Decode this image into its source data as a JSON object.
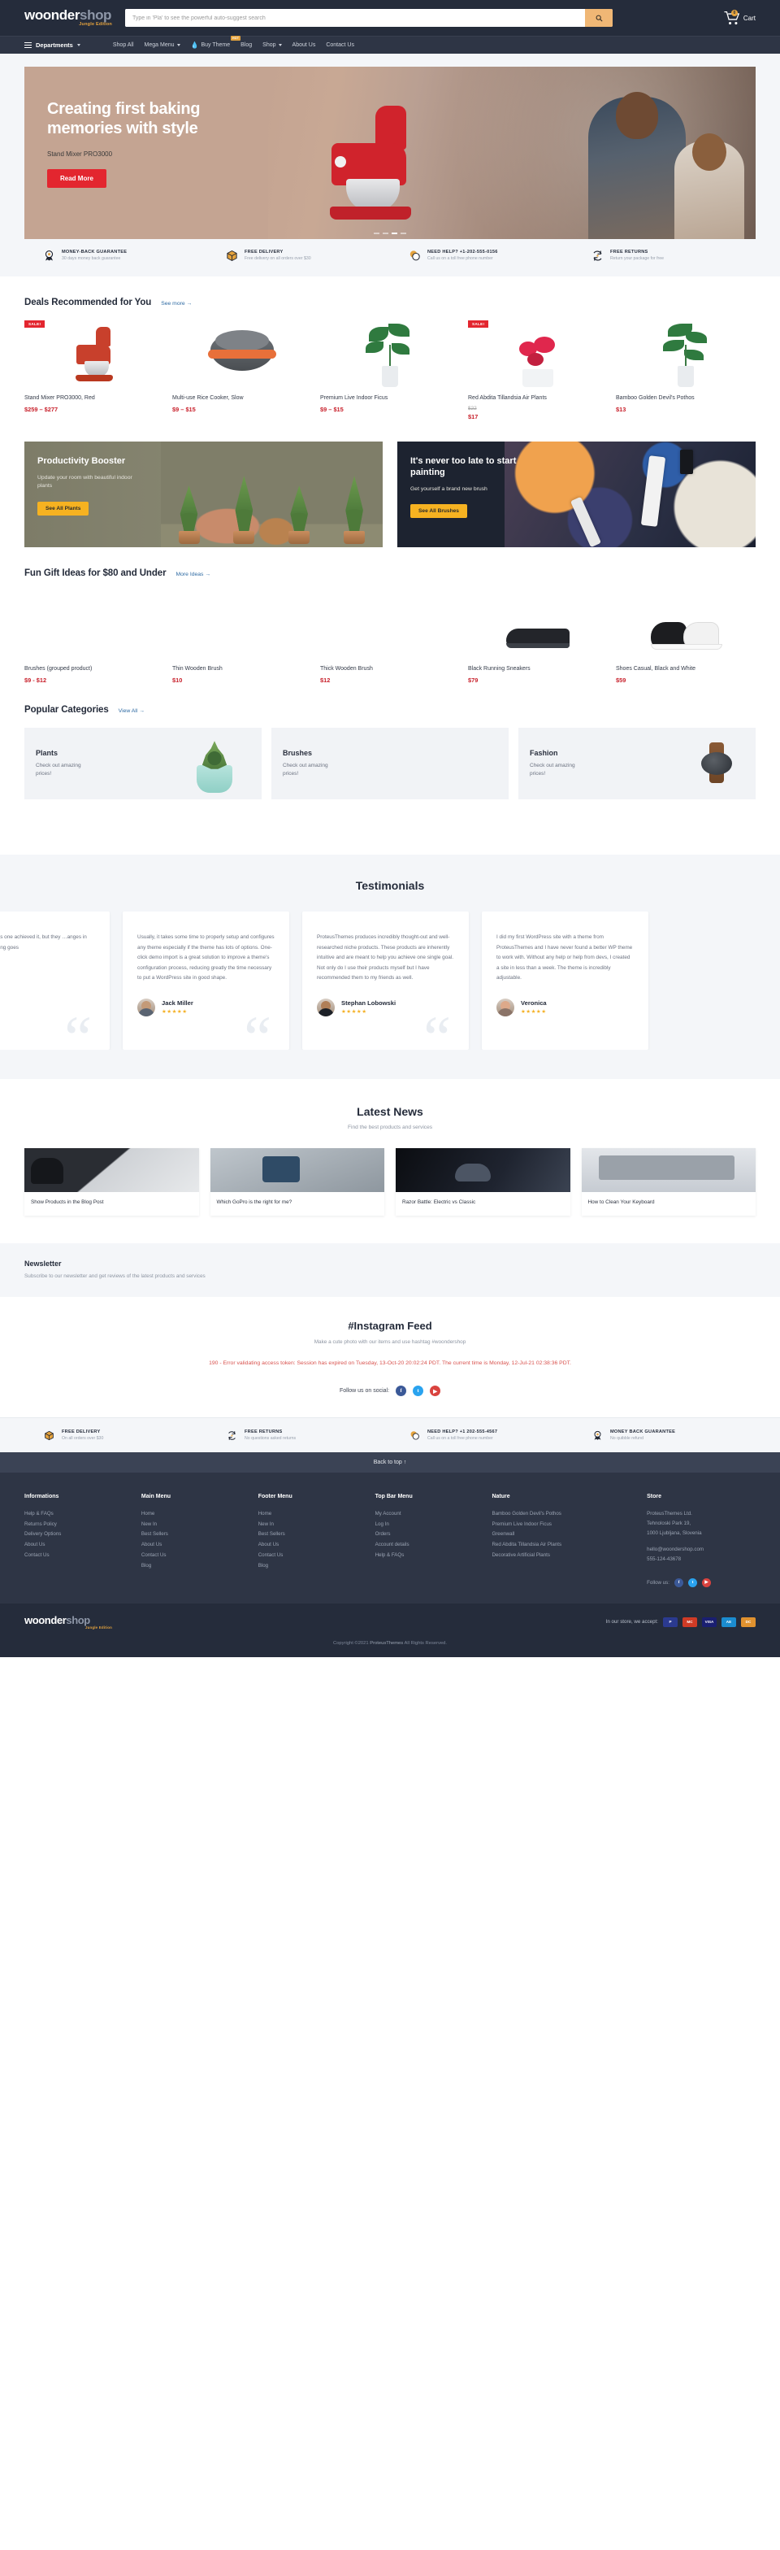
{
  "brand": {
    "name_bold": "woonder",
    "name_light": "shop",
    "tagline": "Jungle Edition"
  },
  "header": {
    "search_placeholder": "Type in 'Pla' to see the powerful auto-suggest search",
    "search_value": "",
    "search_icon": "search-icon",
    "cart_label": "Cart",
    "cart_count": "0",
    "cart_icon": "shopping-cart-icon"
  },
  "nav": {
    "departments_label": "Departments",
    "items": [
      {
        "label": "Shop All",
        "has_caret": false,
        "badge": "",
        "icon": ""
      },
      {
        "label": "Mega Menu",
        "has_caret": true,
        "badge": "",
        "icon": ""
      },
      {
        "label": "Buy Theme",
        "has_caret": false,
        "badge": "HOT",
        "icon": "flame-icon"
      },
      {
        "label": "Blog",
        "has_caret": false,
        "badge": "",
        "icon": ""
      },
      {
        "label": "Shop",
        "has_caret": true,
        "badge": "",
        "icon": ""
      },
      {
        "label": "About Us",
        "has_caret": false,
        "badge": "",
        "icon": ""
      },
      {
        "label": "Contact Us",
        "has_caret": false,
        "badge": "",
        "icon": ""
      }
    ]
  },
  "hero": {
    "title": "Creating first baking memories with style",
    "subtitle": "Stand Mixer PRO3000",
    "button": "Read More",
    "slides": 4,
    "active_slide": 3
  },
  "services": [
    {
      "icon": "medal-icon",
      "title": "MONEY-BACK GUARANTEE",
      "desc": "30 days money back guarantee"
    },
    {
      "icon": "box-icon",
      "title": "FREE DELIVERY",
      "desc": "Free delivery on all orders over $30"
    },
    {
      "icon": "chat-bubbles-icon",
      "title": "NEED HELP? +1-202-555-0156",
      "desc": "Call us on a toll free phone number"
    },
    {
      "icon": "refresh-icon",
      "title": "FREE RETURNS",
      "desc": "Return your package for free"
    }
  ],
  "deals": {
    "title": "Deals Recommended for You",
    "link": "See more →",
    "products": [
      {
        "name": "Stand Mixer PRO3000, Red",
        "price": "$259 – $277",
        "old_price": "",
        "badge": "SALE!",
        "art": "mixer"
      },
      {
        "name": "Multi-use Rice Cooker, Slow",
        "price": "$9 – $15",
        "old_price": "",
        "badge": "",
        "art": "cooker"
      },
      {
        "name": "Premium Live Indoor Ficus",
        "price": "$9 – $15",
        "old_price": "",
        "badge": "",
        "art": "plant"
      },
      {
        "name": "Red Abdita Tillandsia Air Plants",
        "price": "$17",
        "old_price": "$22",
        "badge": "SALE!",
        "art": "flower"
      },
      {
        "name": "Bamboo Golden Devil's Pothos",
        "price": "$13",
        "old_price": "",
        "badge": "",
        "art": "pothos"
      }
    ]
  },
  "promos": [
    {
      "title": "Productivity Booster",
      "sub": "Update your room with beautiful indoor plants",
      "button": "See All Plants",
      "style": "plants"
    },
    {
      "title": "It's never too late to start painting",
      "sub": "Get yourself a brand new brush",
      "button": "See All Brushes",
      "style": "paint"
    }
  ],
  "gifts": {
    "title": "Fun Gift Ideas for $80 and Under",
    "link": "More Ideas →",
    "products": [
      {
        "name": "Brushes (grouped product)",
        "price": "$9 - $12",
        "art": "brushes3"
      },
      {
        "name": "Thin Wooden Brush",
        "price": "$10",
        "art": "brush1"
      },
      {
        "name": "Thick Wooden Brush",
        "price": "$12",
        "art": "brush1"
      },
      {
        "name": "Black Running Sneakers",
        "price": "$79",
        "art": "shoe"
      },
      {
        "name": "Shoes Casual, Black and White",
        "price": "$59",
        "art": "sneakers"
      }
    ]
  },
  "categories": {
    "title": "Popular Categories",
    "link": "View All →",
    "items": [
      {
        "name": "Plants",
        "desc": "Check out amazing prices!",
        "art": "succulent"
      },
      {
        "name": "Brushes",
        "desc": "Check out amazing prices!",
        "art": "brushes"
      },
      {
        "name": "Fashion",
        "desc": "Check out amazing prices!",
        "art": "watch"
      }
    ]
  },
  "testimonials": {
    "title": "Testimonials",
    "items": [
      {
        "text": "…re so well built as one achieved it, but they …anges in the other …verything goes",
        "name": "",
        "stars": "",
        "partial": true
      },
      {
        "text": "Usually, it takes some time to properly setup and configures any theme especially if the theme has lots of options. One-click demo import is a great solution to improve a theme's configuration process, reducing greatly the time necessary to put a WordPress site in good shape.",
        "name": "Jack Miller",
        "stars": "★★★★★",
        "partial": false
      },
      {
        "text": "ProteusThemes produces incredibly thought-out and well-researched niche products. These products are inherently intuitive and are meant to help you achieve one single goal. Not only do I use their products myself but I have recommended them to my friends as well.",
        "name": "Stephan Lobowski",
        "stars": "★★★★★",
        "partial": false
      },
      {
        "text": "I did my first WordPress site with a theme from ProteusThemes and I have never found a better WP theme to work with. Without any help or help from devs, I created a site in less than a week. The theme is incredibly adjustable.",
        "name": "Veronica",
        "stars": "★★★★★",
        "partial": true
      }
    ]
  },
  "news": {
    "title": "Latest News",
    "subtitle": "Find the best products and services",
    "items": [
      {
        "caption": "Show Products in the Blog Post",
        "art": "headphones"
      },
      {
        "caption": "Which GoPro is the right for me?",
        "art": "gopro"
      },
      {
        "caption": "Razor Battle: Electric vs Classic",
        "art": "razor"
      },
      {
        "caption": "How to Clean Your Keyboard",
        "art": "keyboard"
      }
    ]
  },
  "newsletter": {
    "title": "Newsletter",
    "subtitle": "Subscribe to our newsletter and get reviews of the latest products and services"
  },
  "instagram": {
    "title": "#Instagram Feed",
    "subtitle": "Make a cute photo with our items and use hashtag #woondershop",
    "error": "190 - Error validating access token: Session has expired on Tuesday, 13-Oct-20 20:02:24 PDT. The current time is Monday, 12-Jul-21 02:38:36 PDT.",
    "follow_label": "Follow us on social:",
    "socials": [
      "facebook-icon",
      "twitter-icon",
      "youtube-icon"
    ]
  },
  "bottom_services": [
    {
      "icon": "box-icon",
      "title": "FREE DELIVERY",
      "desc": "On all orders over $30"
    },
    {
      "icon": "refresh-icon",
      "title": "FREE RETURNS",
      "desc": "No questions asked returns"
    },
    {
      "icon": "chat-bubbles-icon",
      "title": "NEED HELP? +1 202-555-4567",
      "desc": "Call us on a toll free phone number"
    },
    {
      "icon": "medal-icon",
      "title": "MONEY BACK GUARANTEE",
      "desc": "No quibble refund"
    }
  ],
  "back_to_top": "Back to top ↑",
  "footer": {
    "columns": [
      {
        "heading": "Informations",
        "links": [
          "Help & FAQs",
          "Returns Policy",
          "Delivery Options",
          "About Us",
          "Contact Us"
        ]
      },
      {
        "heading": "Main Menu",
        "links": [
          "Home",
          "New In",
          "Best Sellers",
          "About Us",
          "Contact Us",
          "Blog"
        ]
      },
      {
        "heading": "Footer Menu",
        "links": [
          "Home",
          "New In",
          "Best Sellers",
          "About Us",
          "Contact Us",
          "Blog"
        ]
      },
      {
        "heading": "Top Bar Menu",
        "links": [
          "My Account",
          "Log In",
          "Orders",
          "Account details",
          "Help & FAQs"
        ]
      },
      {
        "heading": "Nature",
        "links": [
          "Bamboo Golden Devil's Pothos",
          "Premium Live Indoor Ficus",
          "Greenwall",
          "Red Abdita Tillandsia Air Plants",
          "Decorative Artificial Plants"
        ]
      }
    ],
    "store": {
      "heading": "Store",
      "lines": [
        "ProteusThemes Ltd.",
        "Tehnoloski Park 19,",
        "1000 Ljubljana, Slovenia"
      ],
      "email": "hello@woondershop.com",
      "phone": "555-124-43678"
    },
    "follow_label": "Follow us:",
    "socials": [
      "facebook-icon",
      "twitter-icon",
      "youtube-icon"
    ]
  },
  "footer_bottom": {
    "payment_label": "In our store, we accept:",
    "payments": [
      "P",
      "MC",
      "VISA",
      "AE",
      "DC"
    ],
    "copyright_prefix": "Copyright ©2021",
    "copyright_link": "ProteusThemes",
    "copyright_suffix": "All Rights Reserved."
  },
  "colors": {
    "dark": "#252c3b",
    "nav": "#2e3545",
    "accent": "#e5a33d",
    "price": "#c8202b",
    "link": "#2f6ba3",
    "cta_yellow": "#f6b221",
    "cta_red": "#e3262f"
  }
}
